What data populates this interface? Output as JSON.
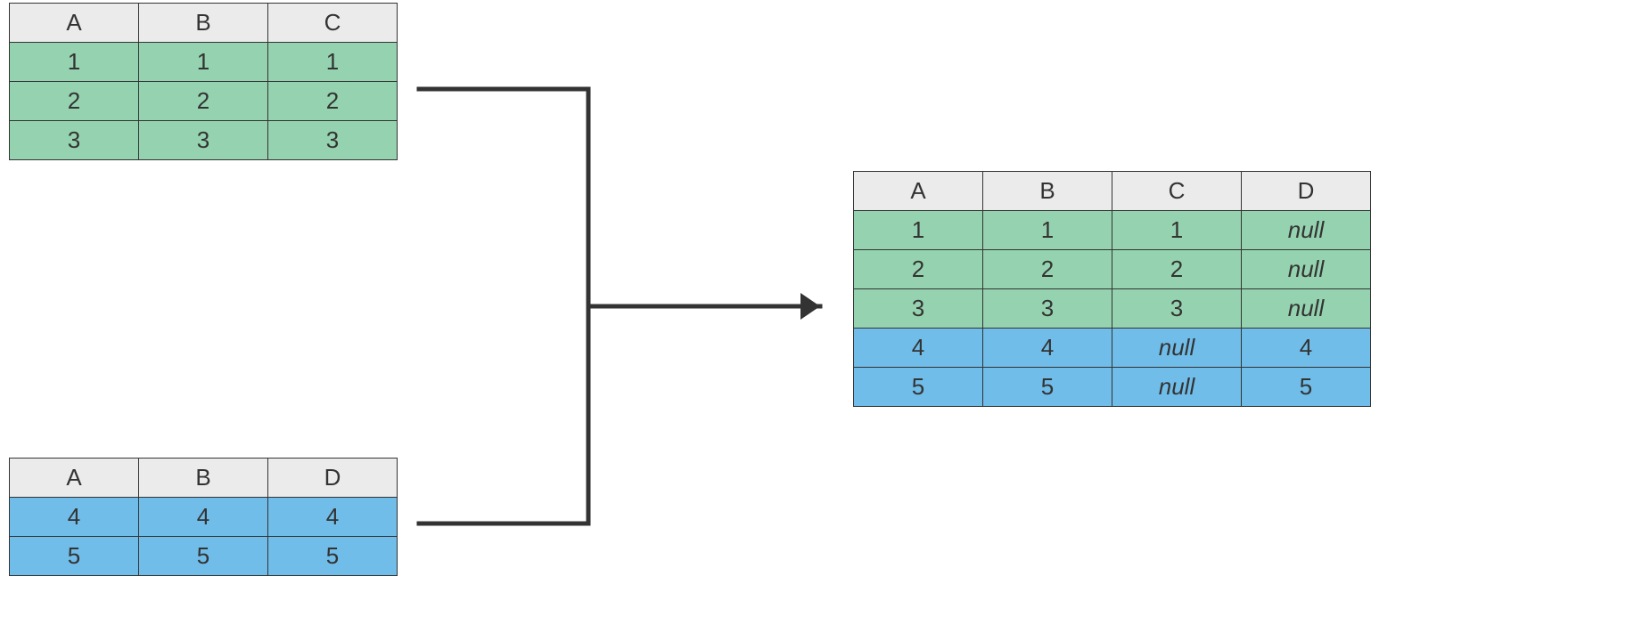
{
  "table1": {
    "headers": [
      "A",
      "B",
      "C"
    ],
    "rows": [
      [
        "1",
        "1",
        "1"
      ],
      [
        "2",
        "2",
        "2"
      ],
      [
        "3",
        "3",
        "3"
      ]
    ],
    "rowClass": "green"
  },
  "table2": {
    "headers": [
      "A",
      "B",
      "D"
    ],
    "rows": [
      [
        "4",
        "4",
        "4"
      ],
      [
        "5",
        "5",
        "5"
      ]
    ],
    "rowClass": "blue"
  },
  "table3": {
    "headers": [
      "A",
      "B",
      "C",
      "D"
    ],
    "rows": [
      {
        "vals": [
          "1",
          "1",
          "1",
          "null"
        ],
        "cls": "green",
        "nullCols": [
          3
        ]
      },
      {
        "vals": [
          "2",
          "2",
          "2",
          "null"
        ],
        "cls": "green",
        "nullCols": [
          3
        ]
      },
      {
        "vals": [
          "3",
          "3",
          "3",
          "null"
        ],
        "cls": "green",
        "nullCols": [
          3
        ]
      },
      {
        "vals": [
          "4",
          "4",
          "null",
          "4"
        ],
        "cls": "blue",
        "nullCols": [
          2
        ]
      },
      {
        "vals": [
          "5",
          "5",
          "null",
          "5"
        ],
        "cls": "blue",
        "nullCols": [
          2
        ]
      }
    ]
  },
  "colors": {
    "headerBg": "#ebebeb",
    "greenBg": "#95d3b0",
    "blueBg": "#70bde9",
    "border": "#333333",
    "arrow": "#333333"
  }
}
